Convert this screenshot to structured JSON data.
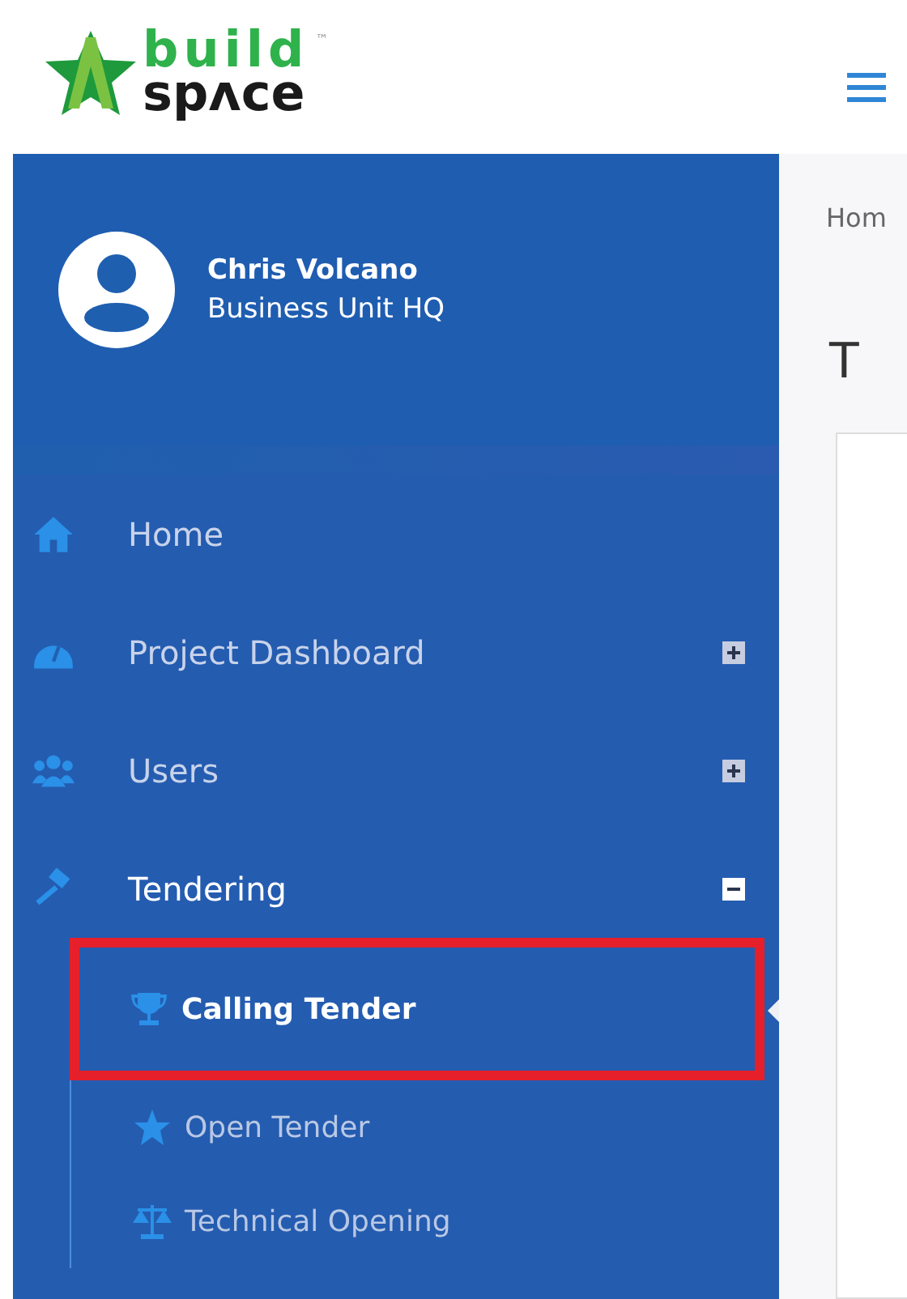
{
  "logo": {
    "top": "build",
    "bottom": "spʌce",
    "trademark": "™"
  },
  "user": {
    "name": "Chris Volcano",
    "unit": "Business Unit HQ"
  },
  "menu": [
    {
      "label": "Home",
      "kind": "link",
      "selected": false
    },
    {
      "label": "Project Dashboard",
      "kind": "group",
      "expanded": false,
      "selected": false
    },
    {
      "label": "Users",
      "kind": "group",
      "expanded": false,
      "selected": false
    },
    {
      "label": "Tendering",
      "kind": "group",
      "expanded": true,
      "selected": true,
      "children": [
        {
          "label": "Calling Tender",
          "selected": true,
          "highlighted": true
        },
        {
          "label": "Open Tender",
          "selected": false,
          "highlighted": false
        },
        {
          "label": "Technical Opening",
          "selected": false,
          "highlighted": false
        }
      ]
    }
  ],
  "breadcrumb": "Hom",
  "page_title": "T"
}
